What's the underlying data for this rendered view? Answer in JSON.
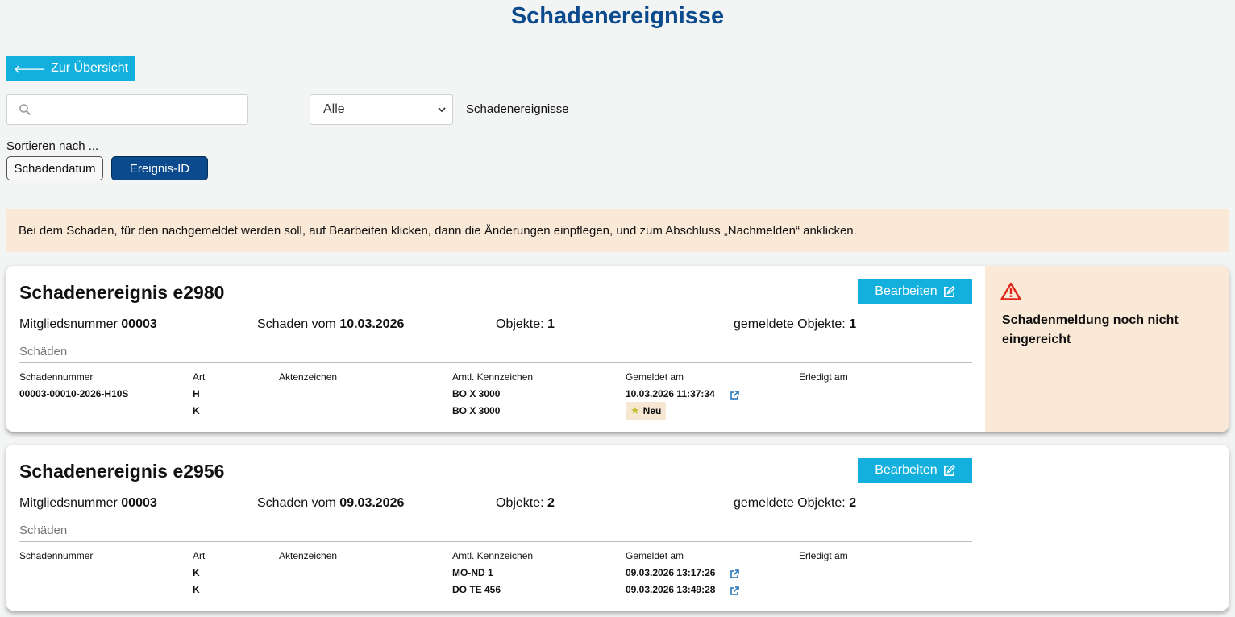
{
  "page": {
    "title": "Schadenereignisse"
  },
  "toolbar": {
    "back_label": "Zur Übersicht",
    "search_placeholder": "",
    "search_value": "",
    "filter_selected": "Alle",
    "filter_label": "Schadenereignisse"
  },
  "sort": {
    "label": "Sortieren nach ...",
    "options": [
      "Schadendatum",
      "Ereignis-ID"
    ],
    "active": "Ereignis-ID"
  },
  "info": "Bei dem Schaden, für den nachgemeldet werden soll, auf Bearbeiten klicken, dann die Änderungen einpflegen, und zum Abschluss „Nachmelden“ anklicken.",
  "labels": {
    "edit": "Bearbeiten",
    "member": "Mitgliedsnummer",
    "damage_from": "Schaden vom",
    "objects": "Objekte:",
    "reported_objects": "gemeldete Objekte:",
    "damages": "Schäden",
    "col_number": "Schadennummer",
    "col_type": "Art",
    "col_file": "Aktenzeichen",
    "col_plate": "Amtl. Kennzeichen",
    "col_reported": "Gemeldet am",
    "col_done": "Erledigt am",
    "new_badge": "Neu"
  },
  "events": [
    {
      "title": "Schadenereignis e2980",
      "member_no": "00003",
      "date": "10.03.2026",
      "objects": "1",
      "reported_objects": "1",
      "status": "Schadenmeldung noch nicht eingereicht",
      "rows": [
        {
          "number": "00003-00010-2026-H10S",
          "type": "H",
          "file": "",
          "plate": "BO X 3000",
          "reported": "10.03.2026 11:37:34",
          "done": ""
        },
        {
          "number": "",
          "type": "K",
          "file": "",
          "plate": "BO X 3000",
          "reported": "",
          "done": ""
        }
      ]
    },
    {
      "title": "Schadenereignis e2956",
      "member_no": "00003",
      "date": "09.03.2026",
      "objects": "2",
      "reported_objects": "2",
      "rows": [
        {
          "number": "",
          "type": "K",
          "file": "",
          "plate": "MO-ND 1",
          "reported": "09.03.2026 13:17:26",
          "done": ""
        },
        {
          "number": "",
          "type": "K",
          "file": "",
          "plate": "DO TE 456",
          "reported": "09.03.2026 13:49:28",
          "done": ""
        }
      ]
    }
  ],
  "colors": {
    "brand": "#0b4a8c",
    "accent": "#13b0dd",
    "info_bg": "#fbe9d7",
    "warning": "#e1261c"
  }
}
